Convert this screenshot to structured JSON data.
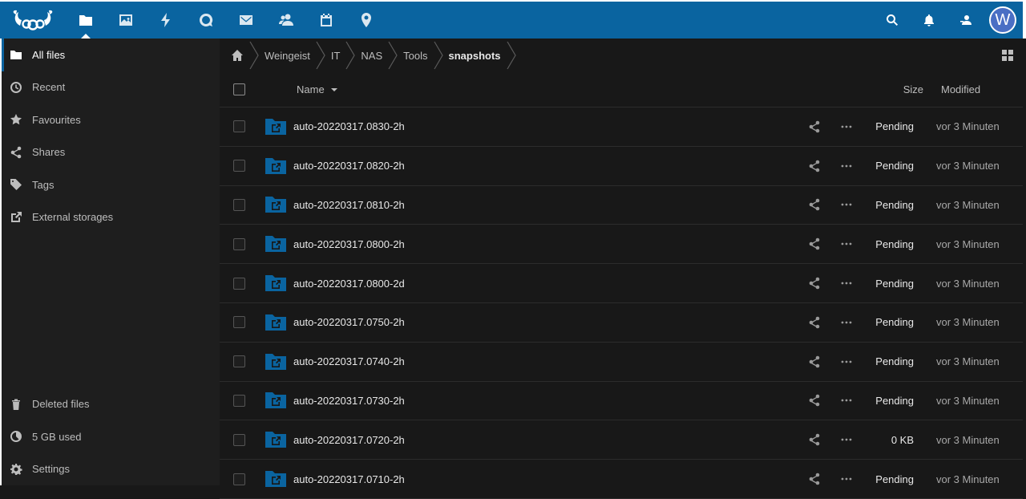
{
  "header": {
    "nav": [
      {
        "name": "nav-files",
        "icon": "folder-icon",
        "label": "Files",
        "active": true
      },
      {
        "name": "nav-photos",
        "icon": "image-icon",
        "label": "Photos"
      },
      {
        "name": "nav-activity",
        "icon": "lightning-icon",
        "label": "Activity"
      },
      {
        "name": "nav-talk",
        "icon": "chat-icon",
        "label": "Talk"
      },
      {
        "name": "nav-mail",
        "icon": "mail-icon",
        "label": "Mail"
      },
      {
        "name": "nav-contacts",
        "icon": "contacts-icon",
        "label": "Contacts"
      },
      {
        "name": "nav-calendar",
        "icon": "calendar-icon",
        "label": "Calendar"
      },
      {
        "name": "nav-maps",
        "icon": "location-pin-icon",
        "label": "Maps"
      }
    ],
    "avatar_letter": "W",
    "avatar_color": "#4a6fc4",
    "brand_color": "#0a64a0"
  },
  "sidebar": {
    "items": [
      {
        "label": "All files",
        "icon": "folder-icon",
        "active": true
      },
      {
        "label": "Recent",
        "icon": "clock-icon"
      },
      {
        "label": "Favourites",
        "icon": "star-icon"
      },
      {
        "label": "Shares",
        "icon": "share-icon"
      },
      {
        "label": "Tags",
        "icon": "tag-icon"
      },
      {
        "label": "External storages",
        "icon": "external-link-icon"
      }
    ],
    "bottom": {
      "deleted": "Deleted files",
      "quota": "5 GB used",
      "settings": "Settings"
    }
  },
  "breadcrumb": [
    "Weingeist",
    "IT",
    "NAS",
    "Tools",
    "snapshots"
  ],
  "table": {
    "col_name": "Name",
    "col_size": "Size",
    "col_modified": "Modified",
    "rows": [
      {
        "name": "auto-20220317.0830-2h",
        "size": "Pending",
        "modified": "vor 3 Minuten"
      },
      {
        "name": "auto-20220317.0820-2h",
        "size": "Pending",
        "modified": "vor 3 Minuten"
      },
      {
        "name": "auto-20220317.0810-2h",
        "size": "Pending",
        "modified": "vor 3 Minuten"
      },
      {
        "name": "auto-20220317.0800-2h",
        "size": "Pending",
        "modified": "vor 3 Minuten"
      },
      {
        "name": "auto-20220317.0800-2d",
        "size": "Pending",
        "modified": "vor 3 Minuten"
      },
      {
        "name": "auto-20220317.0750-2h",
        "size": "Pending",
        "modified": "vor 3 Minuten"
      },
      {
        "name": "auto-20220317.0740-2h",
        "size": "Pending",
        "modified": "vor 3 Minuten"
      },
      {
        "name": "auto-20220317.0730-2h",
        "size": "Pending",
        "modified": "vor 3 Minuten"
      },
      {
        "name": "auto-20220317.0720-2h",
        "size": "0 KB",
        "modified": "vor 3 Minuten"
      },
      {
        "name": "auto-20220317.0710-2h",
        "size": "Pending",
        "modified": "vor 3 Minuten"
      }
    ]
  }
}
